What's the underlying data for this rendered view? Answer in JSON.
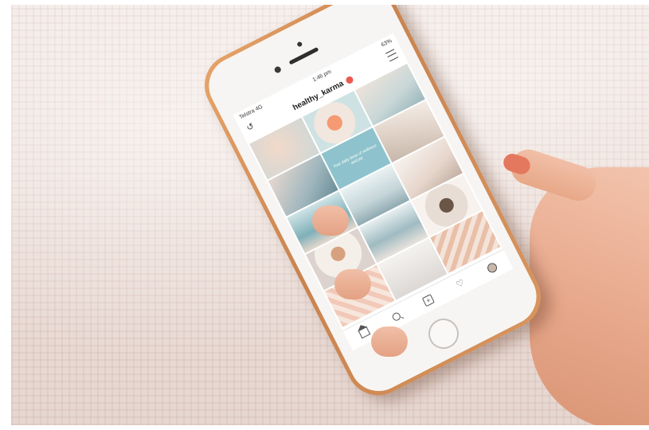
{
  "status_bar": {
    "carrier": "Telstra 4G",
    "time": "1:46 pm",
    "battery": "63%"
  },
  "profile": {
    "username": "healthy_karma"
  },
  "post_text": "Your daily dose of wellness and joy",
  "icons": {
    "back": "back-arrow-icon",
    "menu": "hamburger-menu-icon",
    "tab_bar": [
      "home-icon",
      "search-icon",
      "add-post-icon",
      "heart-icon",
      "profile-icon"
    ]
  },
  "colors": {
    "phone_case": "#d8955e",
    "badge": "#ec5a4f",
    "feature_tile": "#8ec3cd"
  }
}
